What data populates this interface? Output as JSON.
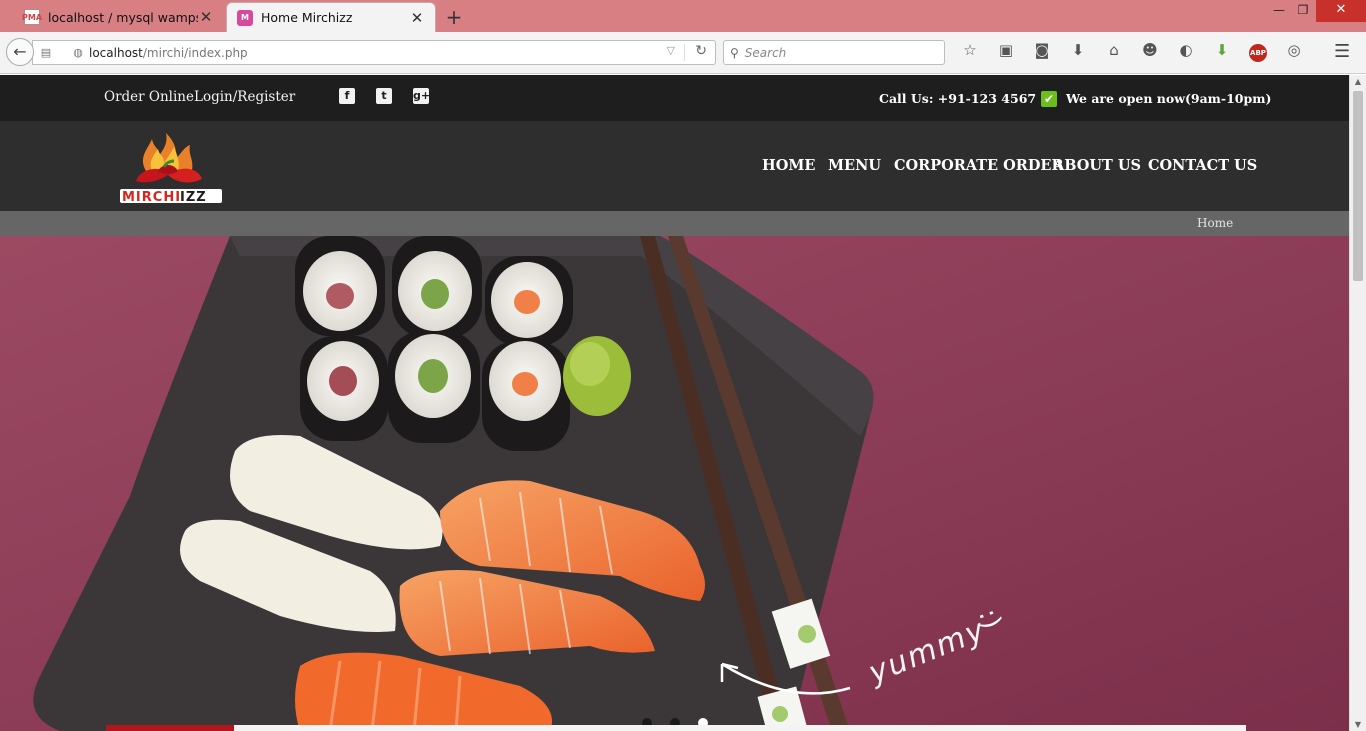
{
  "browser": {
    "tabs": [
      {
        "label": "localhost / mysql wampse...",
        "favicon": "PMA"
      },
      {
        "label": "Home Mirchizz",
        "favicon": "M"
      }
    ],
    "url_host": "localhost",
    "url_path": "/mirchi/index.php",
    "search_placeholder": "Search",
    "window_controls": {
      "minimize": "—",
      "restore": "❐",
      "close": "✕"
    }
  },
  "topbar": {
    "order_online": "Order Online",
    "login_register": "Login/Register",
    "social_icons": [
      "facebook-icon",
      "twitter-icon",
      "google-plus-icon"
    ],
    "call_label": "Call Us:  +91-123 4567",
    "open_status": "We are open now(9am-10pm)"
  },
  "logo": {
    "text_dark": "MIRCHI",
    "text_accent": "IZZ"
  },
  "nav": {
    "items": [
      "HOME",
      "MENU",
      "CORPORATE ORDER",
      "ABOUT US",
      "CONTACT US"
    ]
  },
  "breadcrumb": {
    "current": "Home"
  },
  "hero": {
    "caption": "yummy",
    "smile": ":)",
    "slides": 3,
    "active_slide": 3
  },
  "colors": {
    "tab_strip": "#d87f84",
    "topbar": "#1e1e1e",
    "header": "#2e2e2e",
    "breadcrumb_bar": "#666666",
    "hero_background": "#93405a",
    "open_check": "#6dbe1d"
  }
}
